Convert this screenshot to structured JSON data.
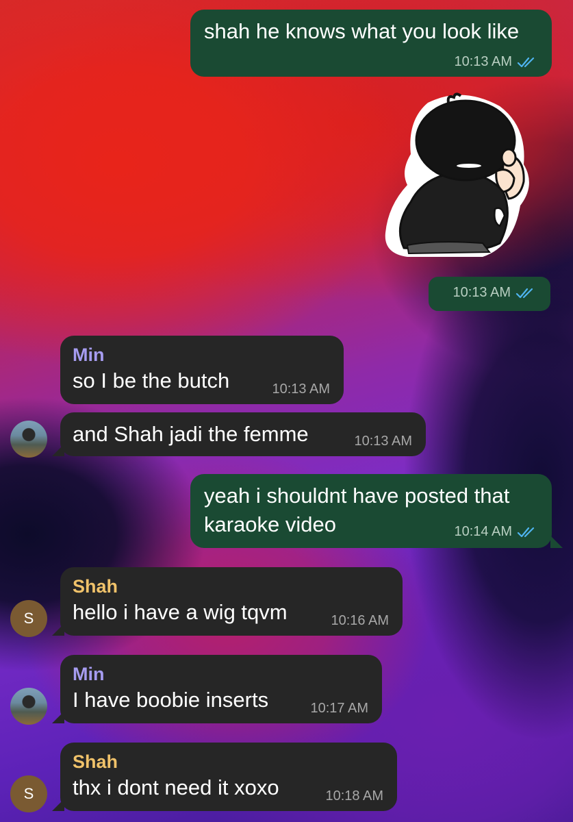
{
  "messages": [
    {
      "text": "shah he knows what you look like",
      "time": "10:13 AM",
      "status": "read"
    },
    {
      "sticker": "crouching-person-sticker",
      "time": "10:13 AM",
      "status": "read"
    },
    {
      "sender": "Min",
      "text": "so I be the butch",
      "time": "10:13 AM"
    },
    {
      "text": "and Shah jadi the femme",
      "time": "10:13 AM"
    },
    {
      "text_line1": "yeah i shouldnt have posted that",
      "text_line2": "karaoke video",
      "time": "10:14 AM",
      "status": "read"
    },
    {
      "sender": "Shah",
      "text": "hello i have a wig tqvm",
      "time": "10:16 AM",
      "avatar_letter": "S"
    },
    {
      "sender": "Min",
      "text": "I have boobie inserts",
      "time": "10:17 AM"
    },
    {
      "sender": "Shah",
      "text": "thx i dont need it xoxo",
      "time": "10:18 AM",
      "avatar_letter": "S"
    }
  ],
  "colors": {
    "outgoing_bubble": "#1a4a33",
    "incoming_bubble": "#262626",
    "sender_min": "#a69cf0",
    "sender_shah": "#f0c26a",
    "read_check": "#4fb4f0",
    "avatar_letter_bg": "#7a5a32"
  },
  "icons": {
    "read_receipt": "double-check-icon",
    "avatar_min": "user-photo-avatar",
    "avatar_shah": "letter-avatar"
  }
}
